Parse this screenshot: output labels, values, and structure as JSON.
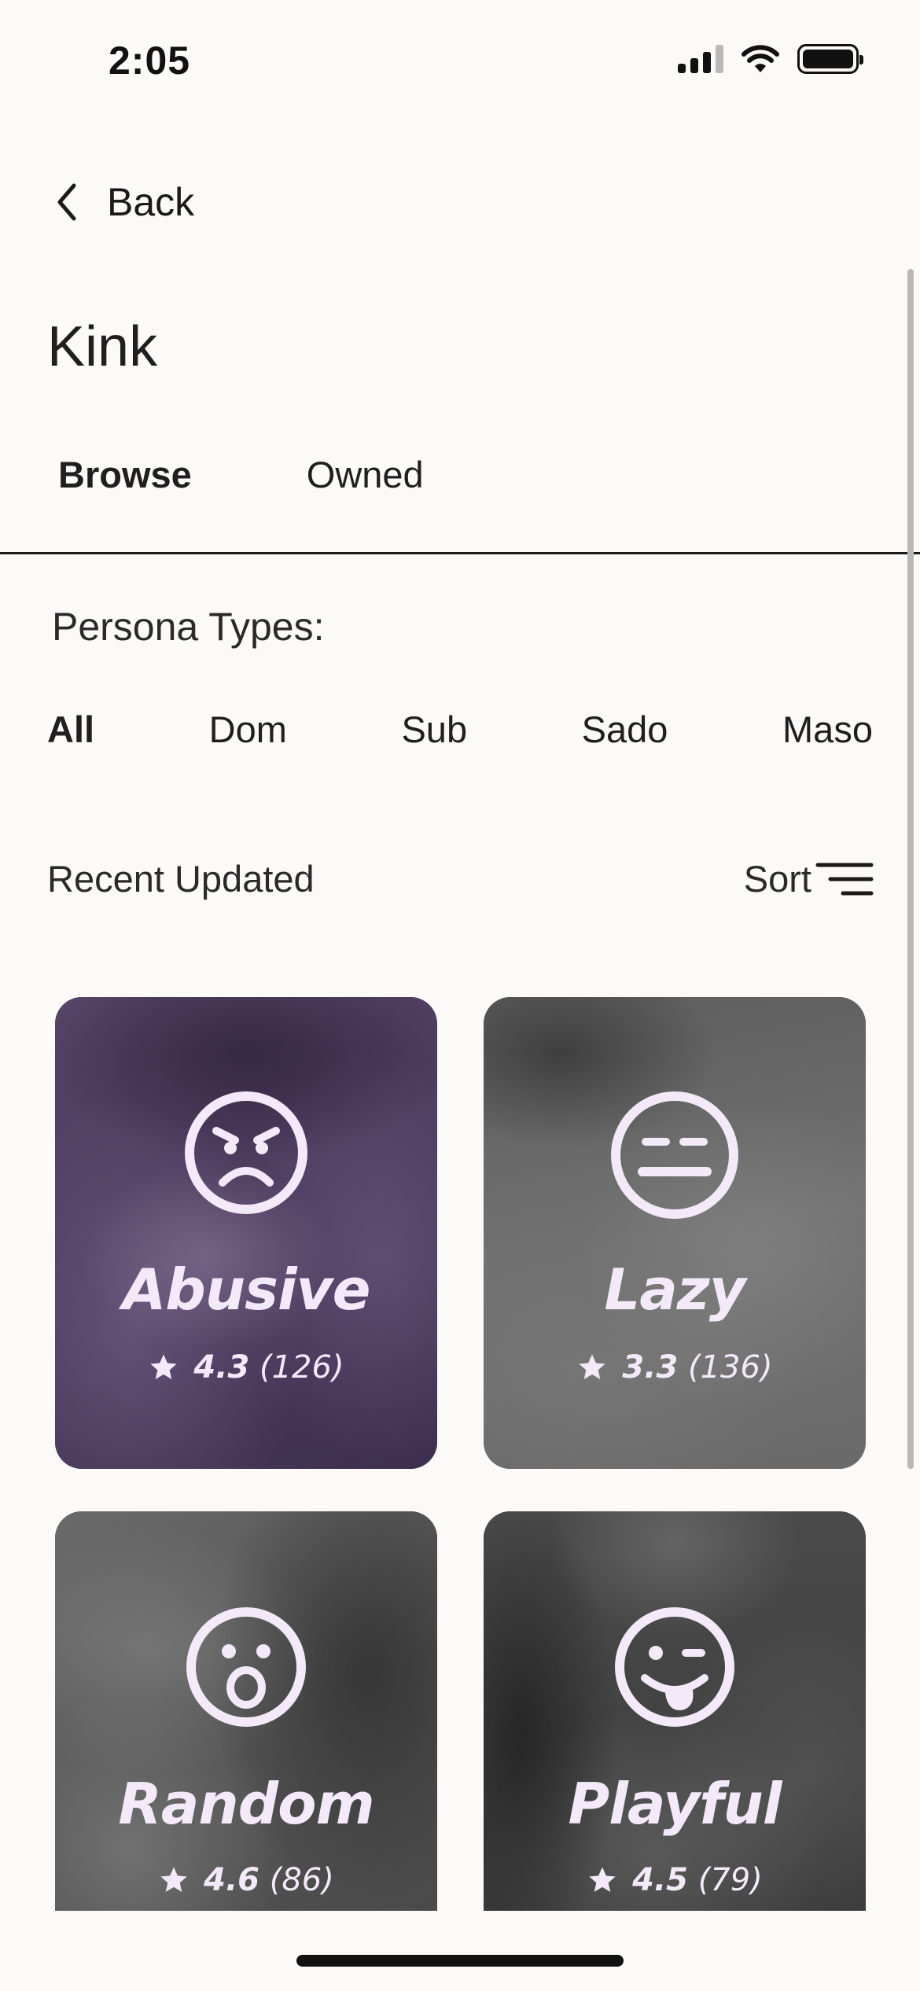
{
  "status_bar": {
    "time": "2:05",
    "icons": [
      "cellular-signal-icon",
      "wifi-icon",
      "battery-icon"
    ]
  },
  "nav": {
    "back_label": "Back",
    "back_icon": "chevron-left-icon"
  },
  "page": {
    "title": "Kink"
  },
  "tabs": [
    {
      "label": "Browse",
      "active": true
    },
    {
      "label": "Owned",
      "active": false
    }
  ],
  "persona_section": {
    "label": "Persona Types:",
    "types": [
      {
        "label": "All",
        "active": true
      },
      {
        "label": "Dom",
        "active": false
      },
      {
        "label": "Sub",
        "active": false
      },
      {
        "label": "Sado",
        "active": false
      },
      {
        "label": "Maso",
        "active": false
      }
    ]
  },
  "list_header": {
    "label": "Recent Updated",
    "sort_label": "Sort",
    "sort_icon": "sort-lines-icon"
  },
  "cards": [
    {
      "name": "Abusive",
      "score": "4.3",
      "count": "(126)",
      "icon": "angry-face-icon",
      "tint": "#4a3a5a"
    },
    {
      "name": "Lazy",
      "score": "3.3",
      "count": "(136)",
      "icon": "neutral-face-icon",
      "tint": "#6d6d6d"
    },
    {
      "name": "Random",
      "score": "4.6",
      "count": "(86)",
      "icon": "surprised-face-icon",
      "tint": "#505050"
    },
    {
      "name": "Playful",
      "score": "4.5",
      "count": "(79)",
      "icon": "tongue-out-face-icon",
      "tint": "#3c3c3c"
    }
  ],
  "colors": {
    "background": "#fcfaf9",
    "card_text": "#f3e9f8",
    "primary_text": "#1a1a1a"
  }
}
